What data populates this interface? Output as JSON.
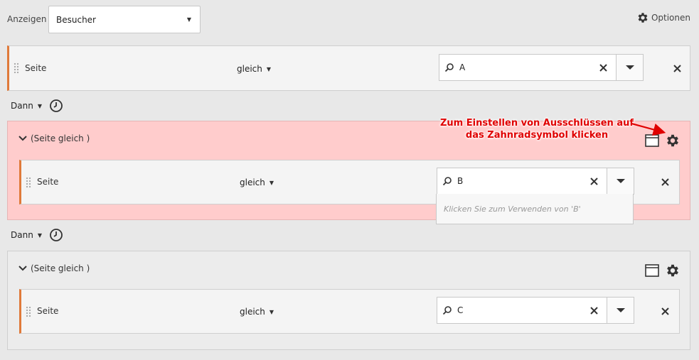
{
  "toolbar": {
    "show_label": "Anzeigen",
    "show_value": "Besucher",
    "options_label": "Optionen"
  },
  "rule_top": {
    "dimension": "Seite",
    "operator": "gleich",
    "value": "A"
  },
  "then_1": {
    "label": "Dann"
  },
  "container_1": {
    "title": "(Seite gleich )",
    "rule": {
      "dimension": "Seite",
      "operator": "gleich",
      "value": "B"
    },
    "suggestion": "Klicken Sie zum Verwenden von 'B'"
  },
  "then_2": {
    "label": "Dann"
  },
  "container_2": {
    "title": "(Seite gleich )",
    "rule": {
      "dimension": "Seite",
      "operator": "gleich",
      "value": "C"
    }
  },
  "annotation": {
    "line1": "Zum Einstellen von Ausschlüssen auf",
    "line2": "das Zahnradsymbol klicken",
    "color": "#e00000"
  },
  "icons": {
    "gear": "gear-icon",
    "search": "search-icon",
    "clear": "close-icon",
    "remove": "remove-icon",
    "clock": "clock-icon",
    "window": "window-icon",
    "chevron": "chevron-down-icon",
    "grip": "drag-handle-icon"
  },
  "colors": {
    "accent": "#e07a3a",
    "highlight_bg": "#ffcccc"
  }
}
